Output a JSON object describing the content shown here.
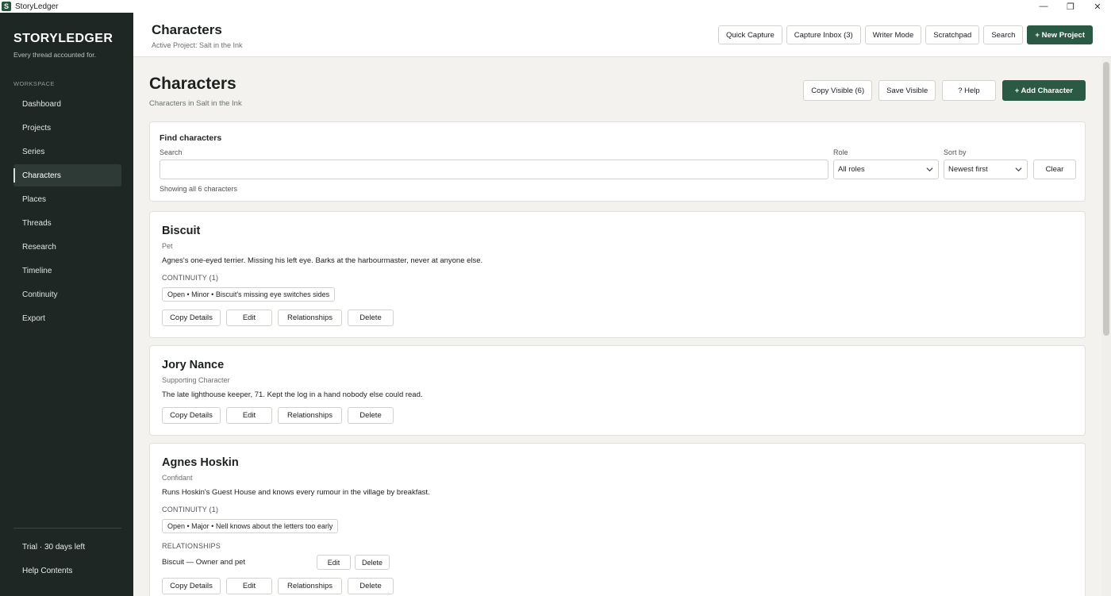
{
  "window": {
    "title": "StoryLedger",
    "icon_letter": "S",
    "controls": [
      "—",
      "❐",
      "✕"
    ]
  },
  "sidebar": {
    "brand": "STORYLEDGER",
    "tagline": "Every thread accounted for.",
    "section_label": "WORKSPACE",
    "items": [
      {
        "label": "Dashboard"
      },
      {
        "label": "Projects"
      },
      {
        "label": "Series"
      },
      {
        "label": "Characters",
        "active": true
      },
      {
        "label": "Places"
      },
      {
        "label": "Threads"
      },
      {
        "label": "Research"
      },
      {
        "label": "Timeline"
      },
      {
        "label": "Continuity"
      },
      {
        "label": "Export"
      }
    ],
    "trial": "Trial · 30 days left",
    "help": "Help Contents"
  },
  "header": {
    "title": "Characters",
    "subtitle": "Active Project: Salt in the Ink",
    "buttons": {
      "quick_capture": "Quick Capture",
      "capture_inbox": "Capture Inbox (3)",
      "writer_mode": "Writer Mode",
      "scratchpad": "Scratchpad",
      "search": "Search",
      "new_project": "+ New Project"
    }
  },
  "page": {
    "title": "Characters",
    "subtitle": "Characters in Salt in the Ink",
    "buttons": {
      "copy_visible": "Copy Visible (6)",
      "save_visible": "Save Visible",
      "help": "? Help",
      "add_character": "+ Add Character"
    }
  },
  "filters": {
    "title": "Find characters",
    "search_label": "Search",
    "search_value": "",
    "role_label": "Role",
    "role_value": "All roles",
    "sort_label": "Sort by",
    "sort_value": "Newest first",
    "clear": "Clear",
    "summary": "Showing all 6 characters"
  },
  "card_buttons": {
    "copy": "Copy Details",
    "edit": "Edit",
    "relationships": "Relationships",
    "delete": "Delete"
  },
  "characters": [
    {
      "name": "Biscuit",
      "role": "Pet",
      "description": "Agnes's one-eyed terrier. Missing his left eye. Barks at the harbourmaster, never at anyone else.",
      "continuity_label": "CONTINUITY (1)",
      "continuity_chip": "Open • Minor • Biscuit's missing eye switches sides"
    },
    {
      "name": "Jory Nance",
      "role": "Supporting Character",
      "description": "The late lighthouse keeper, 71. Kept the log in a hand nobody else could read."
    },
    {
      "name": "Agnes Hoskin",
      "role": "Confidant",
      "description": "Runs Hoskin's Guest House and knows every rumour in the village by breakfast.",
      "continuity_label": "CONTINUITY (1)",
      "continuity_chip": "Open • Major • Nell knows about the letters too early",
      "relationships_label": "RELATIONSHIPS",
      "relationship": "Biscuit — Owner and pet",
      "rel_edit": "Edit",
      "rel_delete": "Delete"
    }
  ]
}
